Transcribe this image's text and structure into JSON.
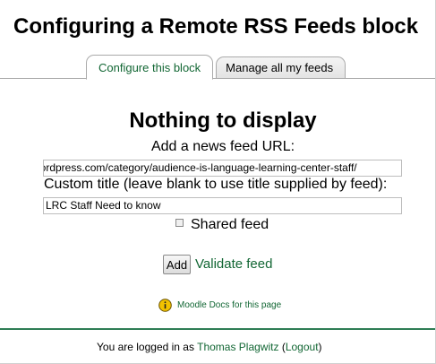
{
  "page": {
    "title": "Configuring a Remote RSS Feeds block"
  },
  "tabs": [
    {
      "label": "Configure this block",
      "active": true
    },
    {
      "label": "Manage all my feeds",
      "active": false
    }
  ],
  "content": {
    "heading": "Nothing to display",
    "url_label": "Add a news feed URL:",
    "url_value": "wordpress.com/category/audience-is-language-learning-center-staff/",
    "custom_title_label": "Custom title (leave blank to use title supplied by feed):",
    "custom_title_value": "LRC Staff Need to know",
    "shared_feed_label": "Shared feed",
    "shared_feed_checked": false,
    "add_button_label": "Add",
    "validate_link": "Validate feed",
    "docs_link": "Moodle Docs for this page",
    "docs_icon": "info-icon"
  },
  "footer": {
    "prefix": "You are logged in as",
    "user_name": "Thomas Plagwitz",
    "open_paren": "(",
    "logout_label": "Logout",
    "close_paren": ")"
  },
  "colors": {
    "link": "#116633",
    "footer_rule": "#2e7d55",
    "info_icon": "#f2c200"
  }
}
